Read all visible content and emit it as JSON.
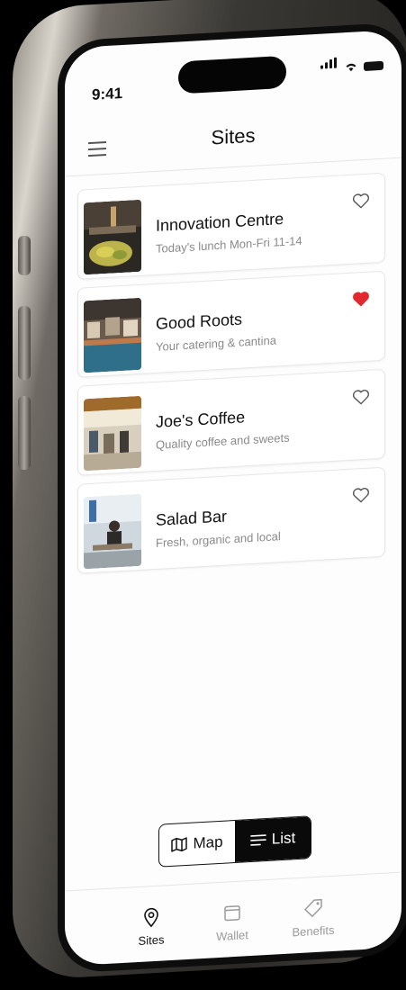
{
  "status_bar": {
    "time": "9:41"
  },
  "header": {
    "title": "Sites",
    "menu_icon": "hamburger-menu-icon"
  },
  "sites": [
    {
      "name": "Innovation Centre",
      "subtitle": "Today's lunch Mon-Fri 11-14",
      "favorite": false,
      "image": "food-counter-photo"
    },
    {
      "name": "Good Roots",
      "subtitle": "Your catering & cantina",
      "favorite": true,
      "image": "cafeteria-interior-photo"
    },
    {
      "name": "Joe's Coffee",
      "subtitle": "Quality coffee and sweets",
      "favorite": false,
      "image": "coffee-shop-photo"
    },
    {
      "name": "Salad Bar",
      "subtitle": "Fresh, organic and local",
      "favorite": false,
      "image": "people-at-table-photo"
    }
  ],
  "view_toggle": {
    "map_label": "Map",
    "list_label": "List",
    "selected": "List"
  },
  "tabbar": {
    "tabs": [
      {
        "label": "Sites",
        "icon": "location-pin-icon",
        "active": true
      },
      {
        "label": "Wallet",
        "icon": "wallet-icon",
        "active": false
      },
      {
        "label": "Benefits",
        "icon": "tag-icon",
        "active": false
      }
    ]
  },
  "colors": {
    "favorite": "#e0282e",
    "active_tab": "#111111",
    "inactive_tab": "#9a9a9a",
    "toggle_active_bg": "#0a0a0a"
  }
}
